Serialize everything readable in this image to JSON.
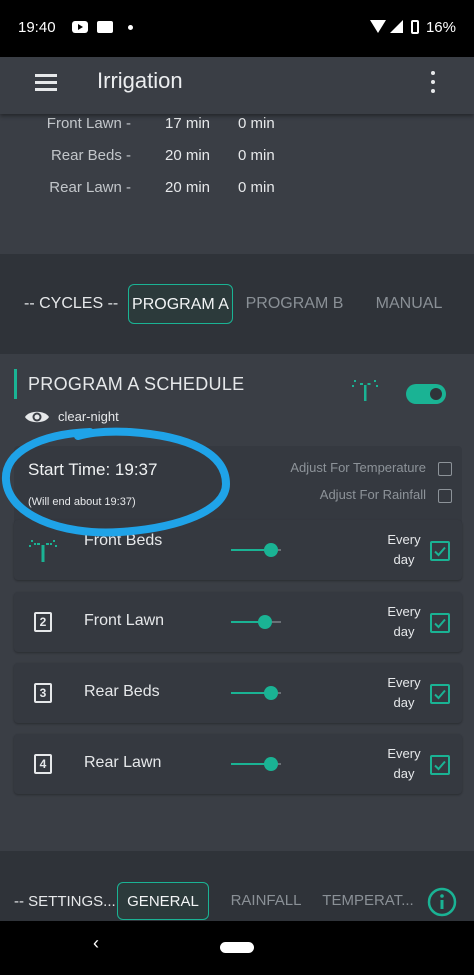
{
  "status_bar": {
    "time": "19:40",
    "battery": "16%",
    "icons": [
      "youtube-icon",
      "card-icon",
      "notification-dot",
      "wifi-icon",
      "signal-icon",
      "battery-icon"
    ]
  },
  "app_bar": {
    "title": "Irrigation",
    "icons": [
      "menu-icon",
      "more-vert-icon"
    ]
  },
  "zone_durations": [
    {
      "name": "Front Lawn -",
      "a": "17 min",
      "b": "0 min"
    },
    {
      "name": "Rear Beds -",
      "a": "20 min",
      "b": "0 min"
    },
    {
      "name": "Rear Lawn -",
      "a": "20 min",
      "b": "0 min"
    }
  ],
  "cycles": {
    "label": "-- CYCLES --",
    "tabs": [
      {
        "label": "PROGRAM A",
        "active": true
      },
      {
        "label": "PROGRAM B",
        "active": false
      },
      {
        "label": "MANUAL",
        "active": false
      }
    ]
  },
  "schedule": {
    "title": "PROGRAM A SCHEDULE",
    "enabled": true,
    "weather": "clear-night",
    "start_time": "Start Time: 19:37",
    "end_about": "(Will end about 19:37)",
    "adjust_temperature": {
      "label": "Adjust For Temperature",
      "checked": false
    },
    "adjust_rainfall": {
      "label": "Adjust For Rainfall",
      "checked": false
    },
    "zones": [
      {
        "num": "",
        "icon": "sprinkler-icon",
        "name": "Front Beds",
        "level": 0.8,
        "freq1": "Every",
        "freq2": "day",
        "checked": true
      },
      {
        "num": "2",
        "icon": "",
        "name": "Front Lawn",
        "level": 0.68,
        "freq1": "Every",
        "freq2": "day",
        "checked": true
      },
      {
        "num": "3",
        "icon": "",
        "name": "Rear Beds",
        "level": 0.8,
        "freq1": "Every",
        "freq2": "day",
        "checked": true
      },
      {
        "num": "4",
        "icon": "",
        "name": "Rear Lawn",
        "level": 0.8,
        "freq1": "Every",
        "freq2": "day",
        "checked": true
      }
    ]
  },
  "settings": {
    "label": "-- SETTINGS...",
    "tabs": [
      {
        "label": "GENERAL",
        "active": true
      },
      {
        "label": "RAINFALL",
        "active": false
      },
      {
        "label": "TEMPERAT...",
        "active": false
      }
    ]
  },
  "colors": {
    "accent": "#1ab394",
    "annotation": "#1fa3e8",
    "background": "#2f3339",
    "card": "#353940"
  }
}
